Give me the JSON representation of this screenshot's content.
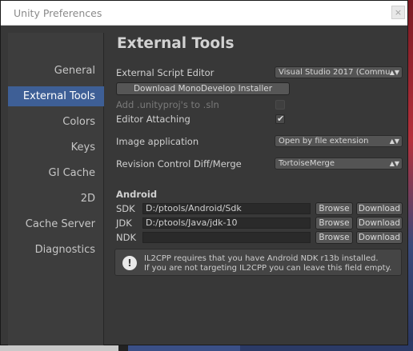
{
  "window": {
    "title": "Unity Preferences",
    "close_label": "×"
  },
  "sidebar": {
    "items": [
      {
        "label": "General"
      },
      {
        "label": "External Tools",
        "active": true
      },
      {
        "label": "Colors"
      },
      {
        "label": "Keys"
      },
      {
        "label": "GI Cache"
      },
      {
        "label": "2D"
      },
      {
        "label": "Cache Server"
      },
      {
        "label": "Diagnostics"
      }
    ]
  },
  "main": {
    "heading": "External Tools",
    "script_editor": {
      "label": "External Script Editor",
      "value": "Visual Studio 2017 (Commu"
    },
    "download_mono_label": "Download MonoDevelop Installer",
    "add_unityproj": {
      "label": "Add .unityproj's to .sln",
      "checked": false,
      "enabled": false
    },
    "editor_attaching": {
      "label": "Editor Attaching",
      "checked": true,
      "tick": "✔"
    },
    "image_app": {
      "label": "Image application",
      "value": "Open by file extension"
    },
    "diff_merge": {
      "label": "Revision Control Diff/Merge",
      "value": "TortoiseMerge"
    },
    "dropdown_arrow": "▲▼",
    "android": {
      "title": "Android",
      "browse_label": "Browse",
      "download_label": "Download",
      "sdk": {
        "label": "SDK",
        "path": "D:/ptools/Android/Sdk"
      },
      "jdk": {
        "label": "JDK",
        "path": "D:/ptools/Java/jdk-10"
      },
      "ndk": {
        "label": "NDK",
        "path": ""
      }
    },
    "info": {
      "icon": "!",
      "line1": "IL2CPP requires that you have Android NDK r13b installed.",
      "line2": "If you are not targeting IL2CPP you can leave this field empty."
    }
  },
  "colors": {
    "accent": "#3e5f96",
    "panel": "#383838",
    "sidebar": "#3d3d3d"
  }
}
